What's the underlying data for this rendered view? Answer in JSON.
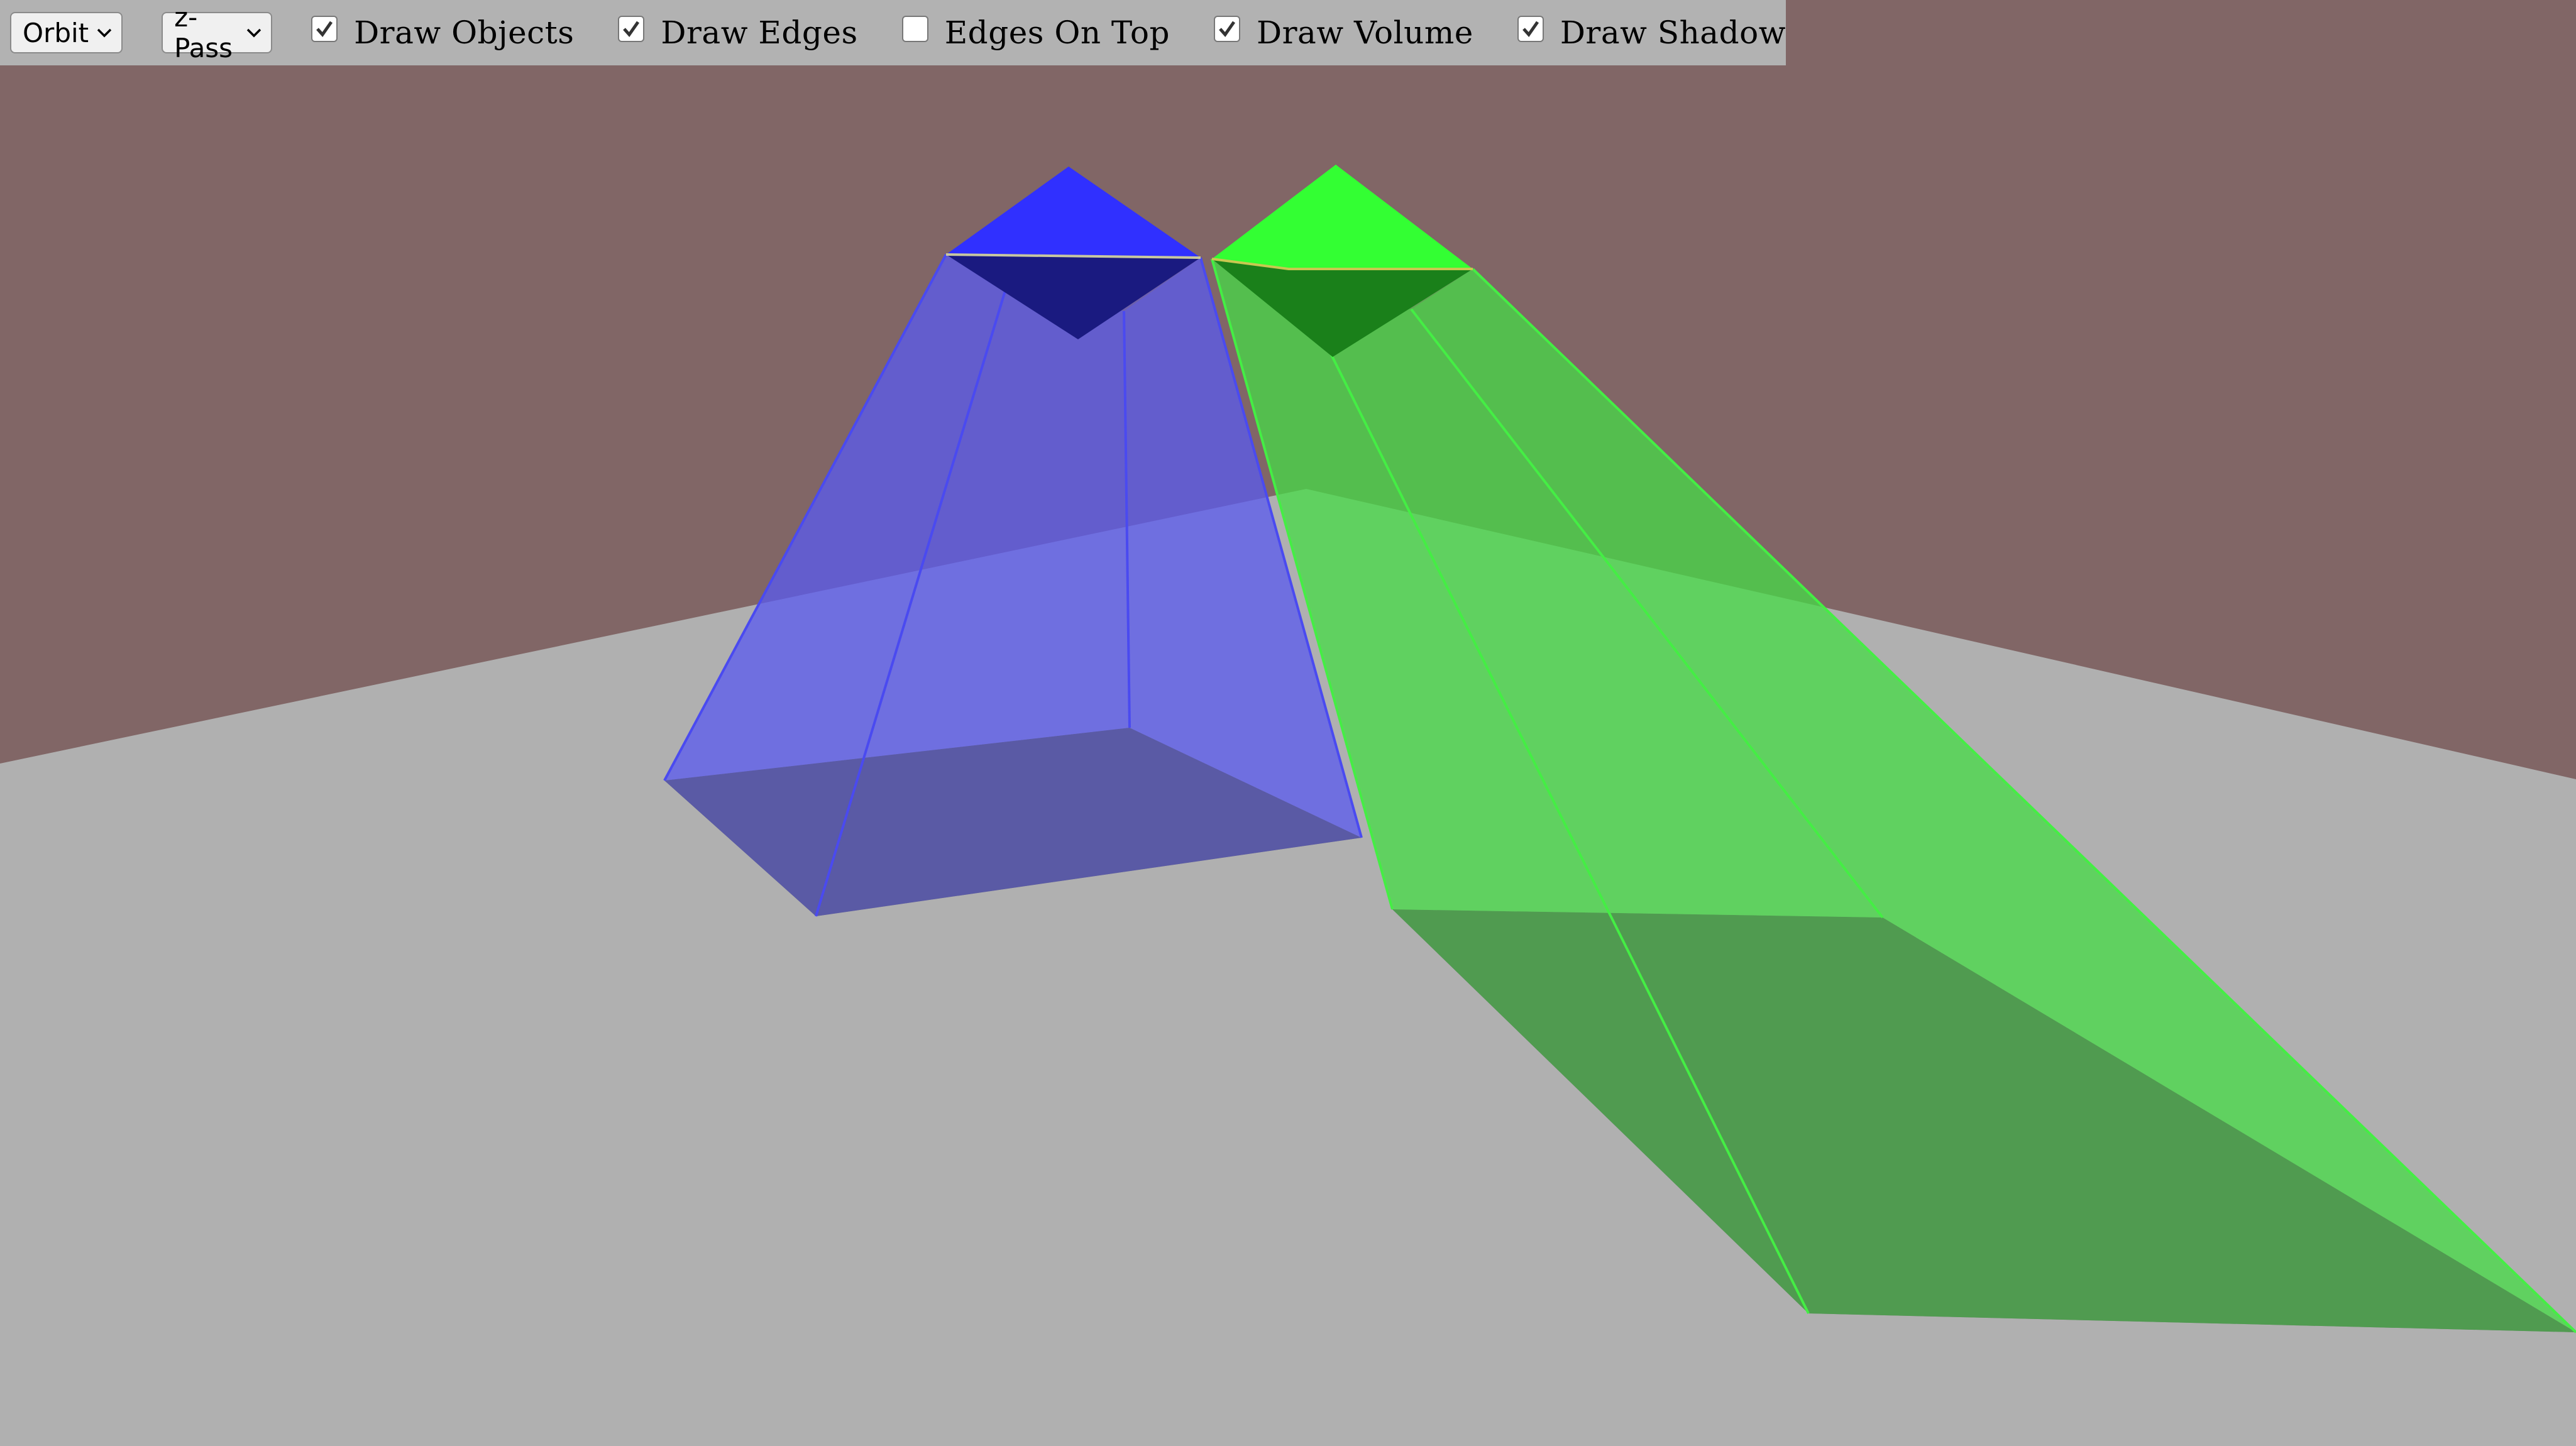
{
  "toolbar": {
    "camera_select": {
      "value": "Orbit",
      "icon": "chevron-down-icon"
    },
    "shadow_mode_select": {
      "value": "z-Pass",
      "icon": "chevron-down-icon"
    },
    "checkboxes": [
      {
        "label": "Draw Objects",
        "checked": true
      },
      {
        "label": "Draw Edges",
        "checked": true
      },
      {
        "label": "Edges On Top",
        "checked": false
      },
      {
        "label": "Draw Volume",
        "checked": true
      },
      {
        "label": "Draw Shadow",
        "checked": true
      }
    ]
  },
  "colors": {
    "wall": "#816666",
    "floor": "#b0b0b0",
    "shadow": "#5a5a5a",
    "blue_object": "#3030ff",
    "blue_object_underside": "#1a1a80",
    "green_object": "#33ff33",
    "green_object_underside": "#1a801a",
    "blue_volume": "rgba(90,90,240,0.5)",
    "green_volume": "rgba(70,220,70,0.5)",
    "blue_edge": "#4a4af0",
    "green_edge": "#44ee44"
  }
}
